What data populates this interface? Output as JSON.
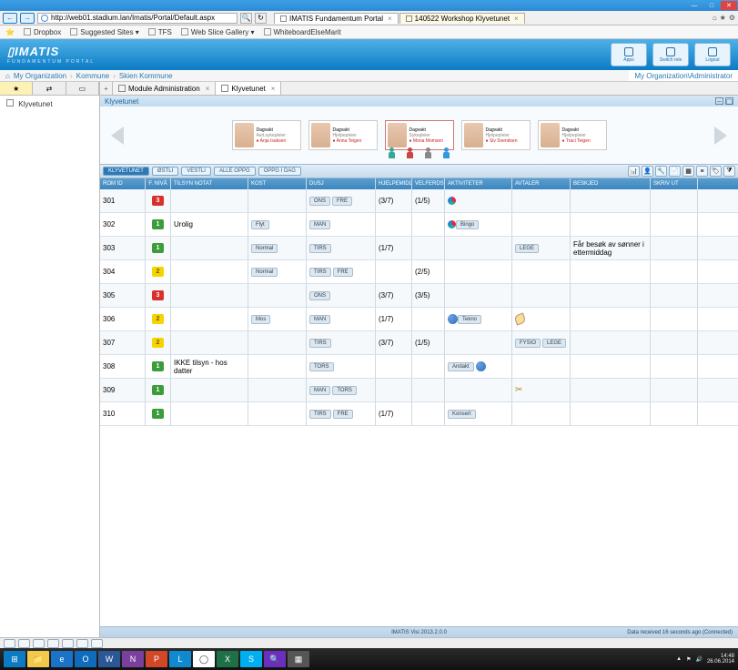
{
  "window": {
    "min": "—",
    "max": "□",
    "close": "✕"
  },
  "ie": {
    "url": "http://web01.stadium.lan/Imatis/Portal/Default.aspx",
    "search_icon": "🔍",
    "refresh": "↻",
    "tabs": [
      {
        "label": "IMATIS Fundamentum Portal",
        "close": "×",
        "active": true
      },
      {
        "label": "140522 Workshop Klyvetunet",
        "close": "×",
        "active": false
      }
    ],
    "home": "⌂",
    "star": "★",
    "gear": "⚙"
  },
  "bookmarks": [
    {
      "label": "Dropbox"
    },
    {
      "label": "Suggested Sites ▾"
    },
    {
      "label": "TFS"
    },
    {
      "label": "Web Slice Gallery ▾"
    },
    {
      "label": "WhiteboardElseMarit"
    }
  ],
  "header": {
    "logo": "▯IMATIS",
    "sublogo": "FUNDAMENTUM PORTAL",
    "btns": [
      {
        "label": "Apps"
      },
      {
        "label": "Switch role"
      },
      {
        "label": "Logout"
      }
    ]
  },
  "crumb": {
    "home": "⌂",
    "a": "My Organization",
    "b": "Kommune",
    "c": "Skien Kommune",
    "right": "My Organization\\Administrator"
  },
  "left": {
    "tabicons": [
      "★",
      "⇄",
      "▭"
    ],
    "item": "Klyvetunet"
  },
  "rtabs": {
    "add": "+",
    "t1": "Module Administration",
    "t2": "Klyvetunet",
    "x": "×"
  },
  "panel": {
    "title": "Klyvetunet"
  },
  "staff": [
    {
      "shift": "Dagvakt",
      "role": "Avd.sykepleier",
      "name": "Anja Isaksen"
    },
    {
      "shift": "Dagvakt",
      "role": "Hjelpepleier",
      "name": "Anna Teigen"
    },
    {
      "shift": "Dagvakt",
      "role": "Sykepleier",
      "name": "Mona Momsen"
    },
    {
      "shift": "Dagvakt",
      "role": "Hjelpepleier",
      "name": "Siv Svendsen"
    },
    {
      "shift": "Dagvakt",
      "role": "Hjelpepleier",
      "name": "Traci Teigen"
    }
  ],
  "filters": {
    "btns": [
      "KLYVETUNET",
      "ØSTLI",
      "VESTLI",
      "ALLE OPPG",
      "OPPG I DAG"
    ]
  },
  "cols": [
    "ROM ID",
    "F. NIVÅ",
    "TILSYN NOTAT",
    "KOST",
    "DUSJ",
    "HJELPEMIDL.",
    "VELFERDSTEK.",
    "AKTIVITETER",
    "AVTALER",
    "BESKJED",
    "SKRIV UT"
  ],
  "rows": [
    {
      "id": "301",
      "lvl": "3",
      "lc": "r",
      "dusj": [
        "ONS",
        "FRE"
      ],
      "hj": "(3/7)",
      "vel": "(1/5)",
      "akt_icon": "dot"
    },
    {
      "id": "302",
      "lvl": "1",
      "lc": "g",
      "notat": "Urolig",
      "kost": "Flyt",
      "dusj": [
        "MAN"
      ],
      "akt_icon": "dot",
      "akt": "Bingo"
    },
    {
      "id": "303",
      "lvl": "1",
      "lc": "g",
      "kost": "Normal",
      "dusj": [
        "TIRS"
      ],
      "hj": "(1/7)",
      "avt": [
        "LEGE"
      ],
      "msg": "Får besøk av sønner i ettermiddag"
    },
    {
      "id": "304",
      "lvl": "2",
      "lc": "y",
      "kost": "Normal",
      "dusj": [
        "TIRS",
        "FRE"
      ],
      "vel": "(2/5)"
    },
    {
      "id": "305",
      "lvl": "3",
      "lc": "r",
      "dusj": [
        "ONS"
      ],
      "hj": "(3/7)",
      "vel": "(3/5)"
    },
    {
      "id": "306",
      "lvl": "2",
      "lc": "y",
      "kost": "Mos",
      "dusj": [
        "MAN"
      ],
      "hj": "(1/7)",
      "akt_icon": "run",
      "akt": "Tekno",
      "avt_icon": "feather"
    },
    {
      "id": "307",
      "lvl": "2",
      "lc": "y",
      "dusj": [
        "TIRS"
      ],
      "hj": "(3/7)",
      "vel": "(1/5)",
      "avt": [
        "FYSIO",
        "LEGE"
      ]
    },
    {
      "id": "308",
      "lvl": "1",
      "lc": "g",
      "notat": "IKKE tilsyn - hos datter",
      "dusj": [
        "TORS"
      ],
      "akt_icon": "run",
      "akt": "Andakt"
    },
    {
      "id": "309",
      "lvl": "1",
      "lc": "g",
      "dusj": [
        "MAN",
        "TORS"
      ],
      "avt_icon": "scissor"
    },
    {
      "id": "310",
      "lvl": "1",
      "lc": "g",
      "dusj": [
        "TIRS",
        "FRE"
      ],
      "hj": "(1/7)",
      "akt": "Konsert"
    }
  ],
  "footer": {
    "version": "IMATIS Visi 2013.2.0.0",
    "status": "Data received 16 seconds ago (Connected)"
  },
  "clock": {
    "time": "14:48",
    "date": "26.06.2014"
  }
}
